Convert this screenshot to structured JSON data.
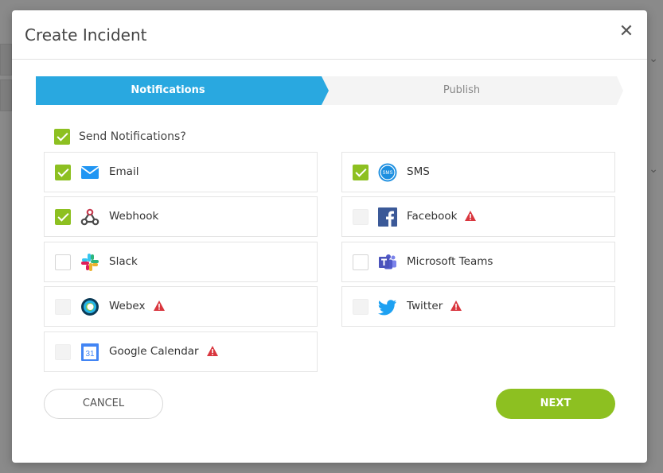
{
  "modal": {
    "title": "Create Incident",
    "close_glyph": "✕"
  },
  "stepper": {
    "steps": [
      {
        "label": "Notifications",
        "active": true
      },
      {
        "label": "Publish",
        "active": false
      }
    ],
    "active_color": "#29a8e0"
  },
  "send_notifications": {
    "label": "Send Notifications?",
    "checked": true
  },
  "channels": {
    "left": [
      {
        "label": "Email",
        "icon": "email-icon",
        "checked": true,
        "disabled": false,
        "warning": false
      },
      {
        "label": "Webhook",
        "icon": "webhook-icon",
        "checked": true,
        "disabled": false,
        "warning": false
      },
      {
        "label": "Slack",
        "icon": "slack-icon",
        "checked": false,
        "disabled": false,
        "warning": false
      },
      {
        "label": "Webex",
        "icon": "webex-icon",
        "checked": false,
        "disabled": true,
        "warning": true
      },
      {
        "label": "Google Calendar",
        "icon": "google-calendar-icon",
        "checked": false,
        "disabled": true,
        "warning": true
      }
    ],
    "right": [
      {
        "label": "SMS",
        "icon": "sms-icon",
        "checked": true,
        "disabled": false,
        "warning": false
      },
      {
        "label": "Facebook",
        "icon": "facebook-icon",
        "checked": false,
        "disabled": true,
        "warning": true
      },
      {
        "label": "Microsoft Teams",
        "icon": "microsoft-teams-icon",
        "checked": false,
        "disabled": false,
        "warning": false
      },
      {
        "label": "Twitter",
        "icon": "twitter-icon",
        "checked": false,
        "disabled": true,
        "warning": true
      }
    ]
  },
  "icon_text": {
    "sms": "SMS",
    "calendar": "31"
  },
  "buttons": {
    "cancel": "CANCEL",
    "next": "NEXT"
  },
  "colors": {
    "accent_green": "#8dc021",
    "accent_blue": "#29a8e0",
    "warning_red": "#d9363e"
  }
}
